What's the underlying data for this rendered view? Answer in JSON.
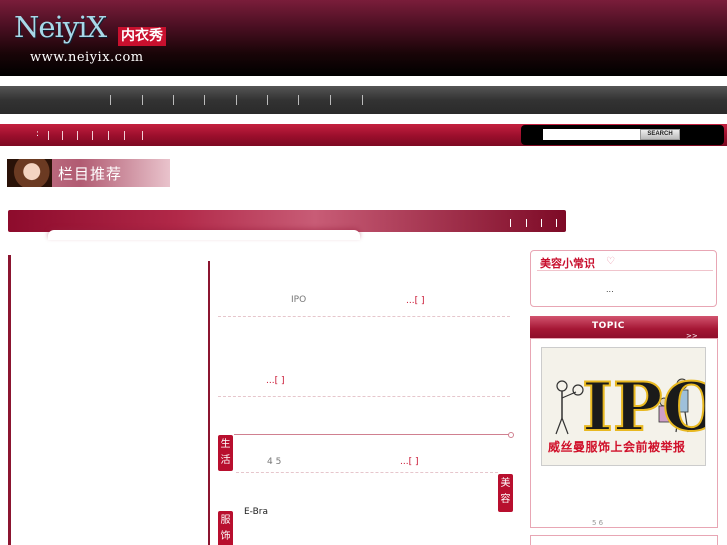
{
  "header": {
    "logo_name": "NeiyiX",
    "logo_cn": "内衣秀",
    "logo_url": "www.neiyix.com"
  },
  "nav_red": {
    "colon": ":"
  },
  "search": {
    "button_label": "SEARCH",
    "value": ""
  },
  "lanmu": {
    "title": "栏目推荐"
  },
  "news": {
    "item1_text": "IPO",
    "item1_more": "...[ ]",
    "item2_more": "...[ ]",
    "item3_text": "4 5",
    "item3_more": "...[ ]",
    "item4_text": "E-Bra"
  },
  "tags": {
    "life": "生活",
    "beauty": "美容",
    "fashion": "服饰"
  },
  "tip": {
    "title": "美容小常识",
    "heart": "♡",
    "body": "..."
  },
  "topic": {
    "title": "TOPIC",
    "arrow": ">>",
    "image_letters": "IPO",
    "caption": "威丝曼服饰上会前被举报",
    "foot": "5 6"
  },
  "colors": {
    "accent": "#c8102e",
    "dark": "#1a0508",
    "nav": "#333333"
  }
}
